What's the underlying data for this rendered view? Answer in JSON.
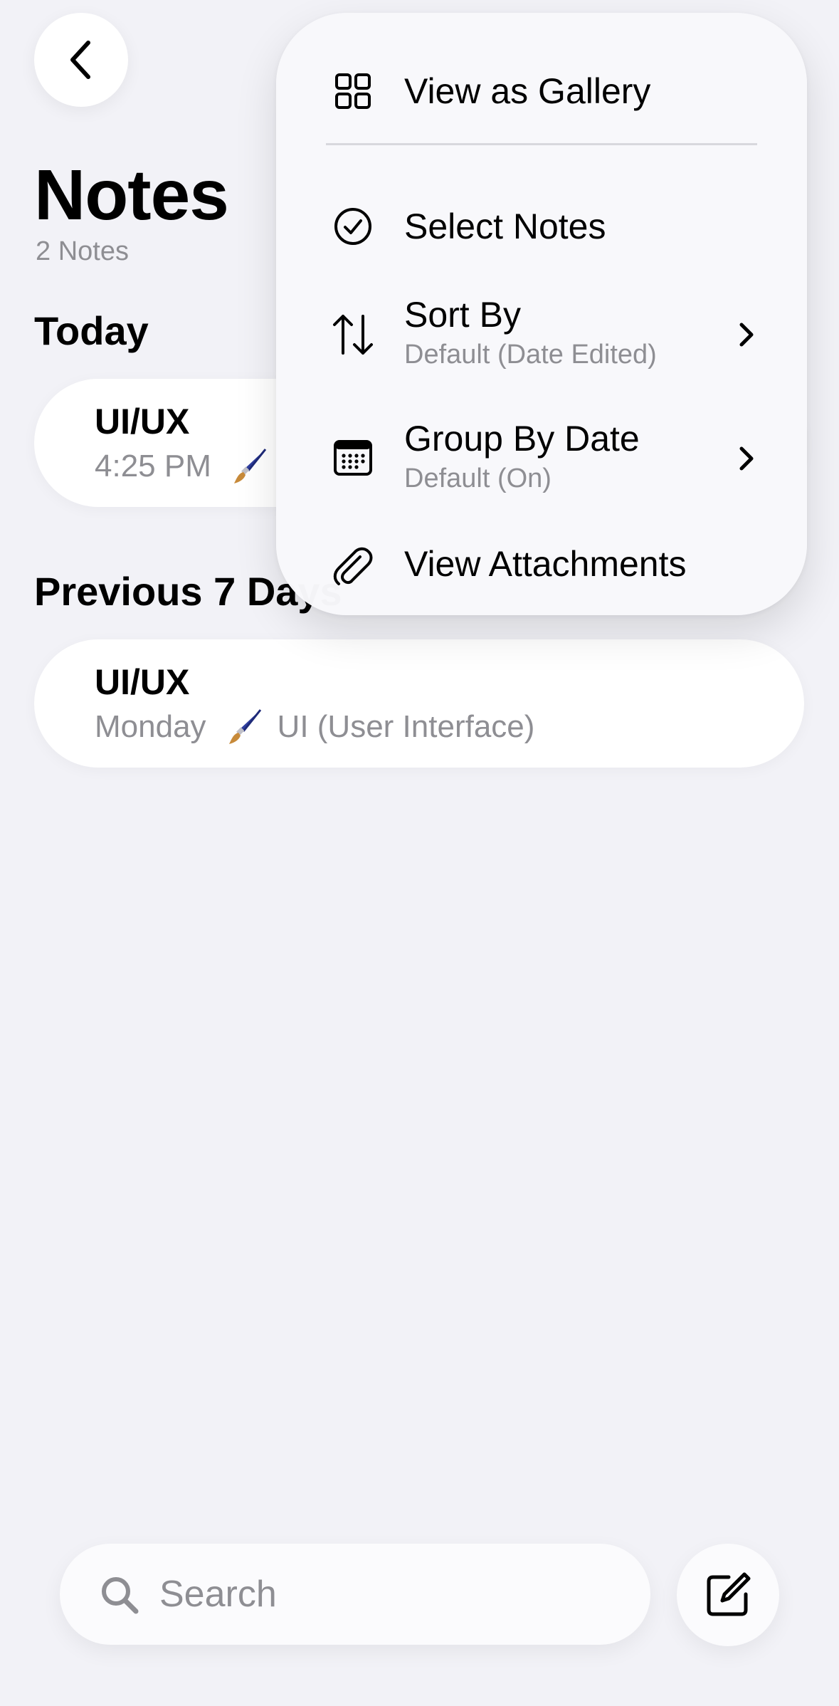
{
  "header": {
    "title": "Notes",
    "count_text": "2 Notes"
  },
  "sections": [
    {
      "header": "Today",
      "notes": [
        {
          "title": "UI/UX",
          "time": "4:25 PM",
          "preview": ""
        }
      ]
    },
    {
      "header": "Previous 7 Days",
      "notes": [
        {
          "title": "UI/UX",
          "time": "Monday",
          "preview": "UI (User Interface)"
        }
      ]
    }
  ],
  "menu": {
    "view_as_gallery": {
      "label": "View as Gallery",
      "icon": "gallery-grid-icon"
    },
    "select_notes": {
      "label": "Select Notes",
      "icon": "checkmark-circle-icon"
    },
    "sort_by": {
      "label": "Sort By",
      "sublabel": "Default (Date Edited)",
      "icon": "sort-arrows-icon"
    },
    "group_by_date": {
      "label": "Group By Date",
      "sublabel": "Default (On)",
      "icon": "calendar-icon"
    },
    "view_attachments": {
      "label": "View Attachments",
      "icon": "paperclip-icon"
    }
  },
  "search": {
    "placeholder": "Search",
    "value": ""
  },
  "icons": {
    "back": "chevron-left-icon",
    "search": "search-icon",
    "compose": "compose-icon",
    "note_emoji": "paintbrush-icon"
  },
  "colors": {
    "background": "#f2f2f7",
    "card": "#ffffff",
    "secondary_text": "#8e8e93",
    "menu_bg": "#f8f8fb"
  }
}
